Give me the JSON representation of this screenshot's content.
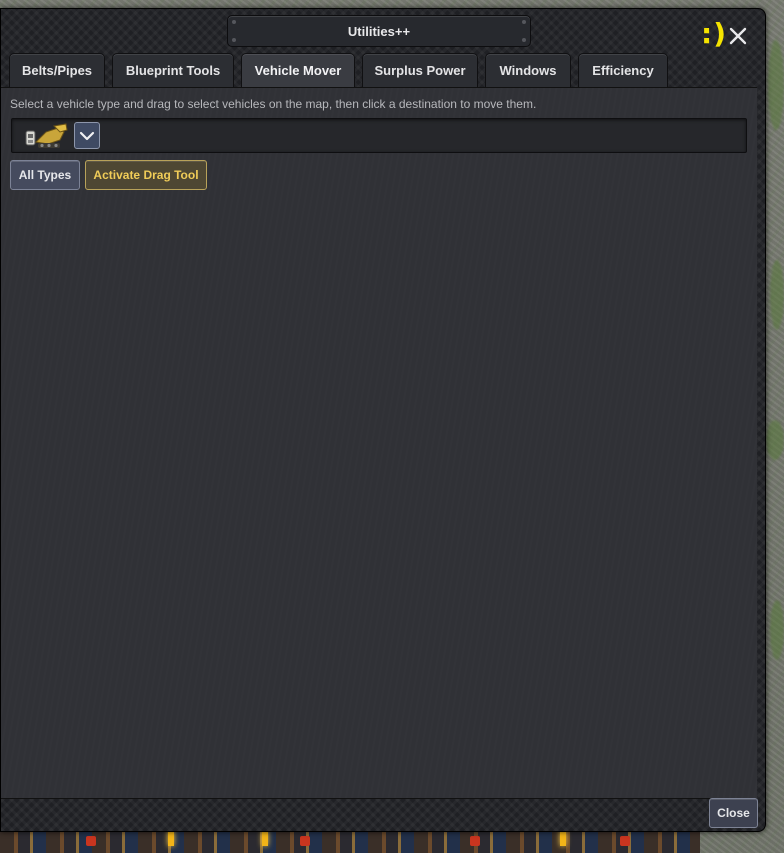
{
  "window": {
    "title": "Utilities++",
    "smiley": ":)",
    "close_icon": "close-icon",
    "footer_close_label": "Close"
  },
  "tabs": [
    {
      "label": "Belts/Pipes",
      "active": false
    },
    {
      "label": "Blueprint Tools",
      "active": false
    },
    {
      "label": "Vehicle Mover",
      "active": true
    },
    {
      "label": "Surplus Power",
      "active": false
    },
    {
      "label": "Windows",
      "active": false
    },
    {
      "label": "Efficiency",
      "active": false
    }
  ],
  "vehicle_mover": {
    "instructions": "Select a vehicle type and drag to select vehicles on the map, then click a destination to move them.",
    "selected_vehicle_icon": "excavator-vehicle-icon",
    "dropdown_icon": "chevron-down-icon",
    "all_types_label": "All Types",
    "activate_drag_label": "Activate Drag Tool"
  },
  "colors": {
    "accent_yellow": "#f5e400",
    "drag_button_text": "#f0cc58",
    "panel_bg": "#303136"
  }
}
